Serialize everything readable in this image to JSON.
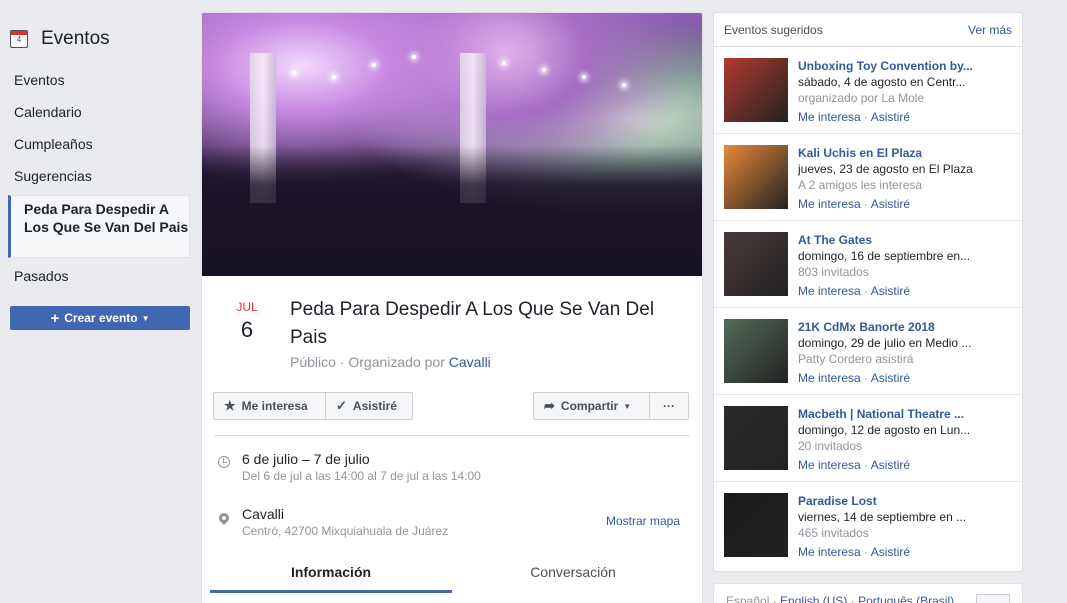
{
  "sidebar": {
    "calendar_day": "4",
    "title": "Eventos",
    "items": [
      "Eventos",
      "Calendario",
      "Cumpleaños",
      "Sugerencias"
    ],
    "active_item": "Peda Para Despedir A Los Que Se Van Del Pais",
    "past": "Pasados",
    "create_button": "Crear evento"
  },
  "event": {
    "month": "JUL",
    "day": "6",
    "title": "Peda Para Despedir A Los Que Se Van Del Pais",
    "privacy": "Público",
    "organized_by": "Organizado por",
    "organizer": "Cavalli",
    "buttons": {
      "interested": "Me interesa",
      "attended": "Asistiré",
      "share": "Compartir",
      "more": "···"
    },
    "date_main": "6 de julio – 7 de julio",
    "date_sub": "Del 6 de jul a las 14:00 al 7 de jul a las 14:00",
    "place_main": "Cavalli",
    "place_sub": "Centró, 42700 Mixquiahuala de Juárez",
    "map_link": "Mostrar mapa",
    "tabs": [
      "Información",
      "Conversación"
    ]
  },
  "suggested": {
    "title": "Eventos sugeridos",
    "see_more": "Ver más",
    "items": [
      {
        "title": "Unboxing Toy Convention by...",
        "when": "sábado, 4 de agosto en Centr...",
        "meta": "organizado por La Mole",
        "thumb_color": "#b23a2e"
      },
      {
        "title": "Kali Uchis en El Plaza",
        "when": "jueves, 23 de agosto en El Plaza",
        "meta": "A 2 amigos les interesa",
        "thumb_color": "#e8893a"
      },
      {
        "title": "At The Gates",
        "when": "domingo, 16 de septiembre en...",
        "meta": "803 invitados",
        "thumb_color": "#4a3a3a"
      },
      {
        "title": "21K CdMx Banorte 2018",
        "when": "domingo, 29 de julio en Medio ...",
        "meta": "Patty Cordero asistirá",
        "thumb_color": "#556b5a"
      },
      {
        "title": "Macbeth | National Theatre ...",
        "when": "domingo, 12 de agosto en Lun...",
        "meta": "20 invitados",
        "thumb_color": "#2a2a2a"
      },
      {
        "title": "Paradise Lost",
        "when": "viernes, 14 de septiembre en ...",
        "meta": "465 invitados",
        "thumb_color": "#1a1a1a"
      }
    ],
    "action_interested": "Me interesa",
    "action_attend": "Asistiré"
  },
  "footer": {
    "lang1": "Español",
    "lang2": "English (US)",
    "lang3": "Português (Brasil)"
  }
}
